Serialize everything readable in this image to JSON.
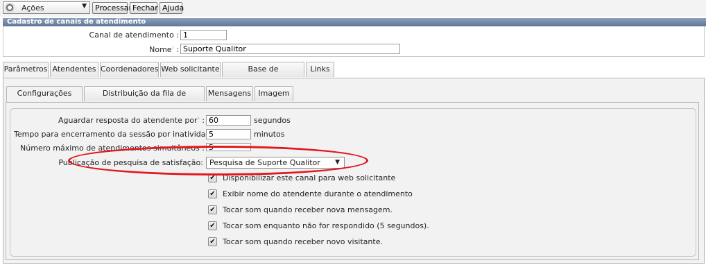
{
  "toolbar": {
    "actions_label": "Ações",
    "process_label": "Processar",
    "close_label": "Fechar",
    "help_label": "Ajuda"
  },
  "panel": {
    "title": "Cadastro de canais de atendimento",
    "channel_label": "Canal de atendimento :",
    "channel_value": "1",
    "name_label": "Nome",
    "name_value": "Suporte Qualitor"
  },
  "outer_tabs": [
    "Parâmetros",
    "Atendentes",
    "Coordenadores",
    "Web solicitante",
    "Base de conhecimento",
    "Links"
  ],
  "inner_tabs": [
    "Configurações gerais",
    "Distribuição da fila de atendimento",
    "Mensagens",
    "Imagem"
  ],
  "fields": {
    "wait_label": "Aguardar resposta do atendente por",
    "wait_value": "60",
    "wait_unit": "segundos",
    "session_label": "Tempo para encerramento da sessão por inatividade",
    "session_value": "5",
    "session_unit": "minutos",
    "max_label": "Número máximo de atendimentos simultâneos",
    "max_value": "5",
    "survey_label": "Publicação de pesquisa de satisfação:",
    "survey_value": "Pesquisa de Suporte Qualitor"
  },
  "checkboxes": [
    {
      "label": "Disponibilizar este canal para web solicitante",
      "checked": true
    },
    {
      "label": "Exibir nome do atendente durante o atendimento",
      "checked": true
    },
    {
      "label": "Tocar som quando receber nova mensagem.",
      "checked": true
    },
    {
      "label": "Tocar som enquanto não for respondido (5 segundos).",
      "checked": true
    },
    {
      "label": "Tocar som quando receber novo visitante.",
      "checked": true
    }
  ],
  "colors": {
    "header_bg": "#6f86a4",
    "annotation_red": "#e1181d",
    "required_mark": "#e08a00"
  },
  "icons": {
    "actions": "gear-icon",
    "dropdown": "triangle-down-icon",
    "checkbox": "check-icon"
  }
}
